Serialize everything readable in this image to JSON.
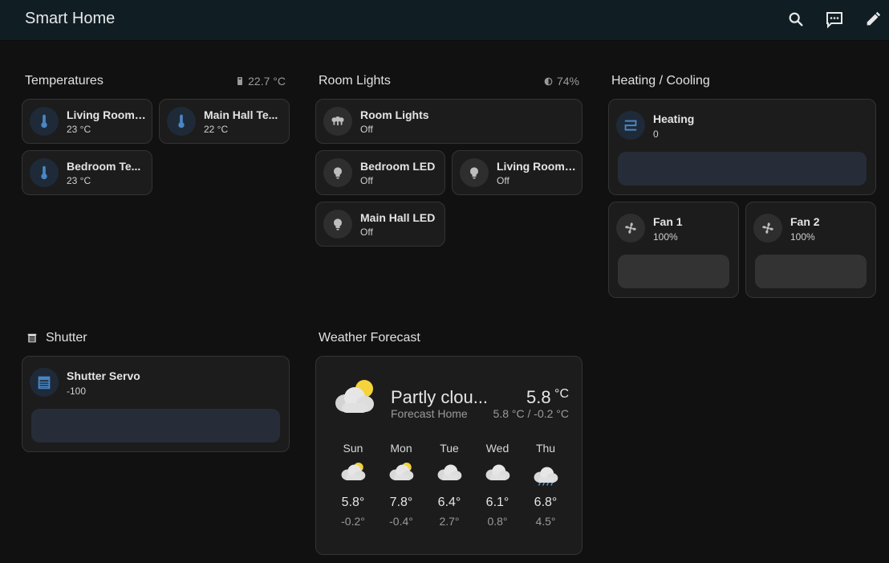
{
  "app": {
    "title": "Smart Home"
  },
  "topbar": {
    "icons": [
      "search-icon",
      "assist-icon",
      "edit-icon"
    ]
  },
  "temperatures": {
    "title": "Temperatures",
    "badge": "22.7 °C",
    "tiles": [
      {
        "name": "Living Room ...",
        "state": "23 °C"
      },
      {
        "name": "Main Hall Te...",
        "state": "22 °C"
      },
      {
        "name": "Bedroom Te...",
        "state": "23 °C"
      }
    ]
  },
  "room_lights": {
    "title": "Room Lights",
    "badge": "74%",
    "group": {
      "name": "Room Lights",
      "state": "Off"
    },
    "tiles": [
      {
        "name": "Bedroom LED",
        "state": "Off"
      },
      {
        "name": "Living Room ...",
        "state": "Off"
      },
      {
        "name": "Main Hall LED",
        "state": "Off"
      }
    ]
  },
  "heating": {
    "title": "Heating / Cooling",
    "heater": {
      "name": "Heating",
      "state": "0"
    },
    "fans": [
      {
        "name": "Fan 1",
        "state": "100%"
      },
      {
        "name": "Fan 2",
        "state": "100%"
      }
    ]
  },
  "shutter": {
    "title": "Shutter",
    "tile": {
      "name": "Shutter Servo",
      "state": "-100"
    }
  },
  "weather": {
    "title": "Weather Forecast",
    "condition": "Partly clou...",
    "location": "Forecast Home",
    "temp_value": "5.8",
    "temp_unit": "°C",
    "range": "5.8 °C / -0.2 °C",
    "days": [
      {
        "day": "Sun",
        "icon": "partly-cloudy",
        "high": "5.8°",
        "low": "-0.2°"
      },
      {
        "day": "Mon",
        "icon": "partly-cloudy",
        "high": "7.8°",
        "low": "-0.4°"
      },
      {
        "day": "Tue",
        "icon": "cloudy",
        "high": "6.4°",
        "low": "2.7°"
      },
      {
        "day": "Wed",
        "icon": "cloudy",
        "high": "6.1°",
        "low": "0.8°"
      },
      {
        "day": "Thu",
        "icon": "rainy",
        "high": "6.8°",
        "low": "4.5°"
      }
    ]
  },
  "colors": {
    "background": "#111111",
    "topbar": "#101e24",
    "card": "#1c1c1c",
    "accent_blue": "#4a86c5",
    "sun": "#f5d33b"
  }
}
